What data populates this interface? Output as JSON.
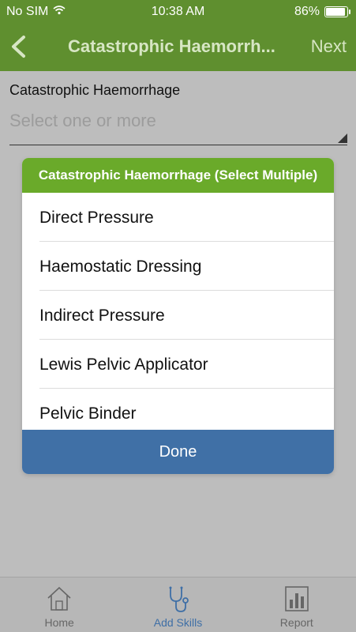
{
  "status_bar": {
    "carrier": "No SIM",
    "time": "10:38 AM",
    "battery_percent": "86%",
    "battery_level": 0.86,
    "icons": [
      "wifi-icon",
      "battery-icon"
    ]
  },
  "nav": {
    "title": "Catastrophic Haemorrh...",
    "next_label": "Next",
    "back_icon": "chevron-left-icon"
  },
  "form": {
    "field_label": "Catastrophic Haemorrhage",
    "placeholder": "Select one or more"
  },
  "modal": {
    "title": "Catastrophic Haemorrhage (Select Multiple)",
    "options": [
      "Direct Pressure",
      "Haemostatic Dressing",
      "Indirect Pressure",
      "Lewis Pelvic Applicator",
      "Pelvic Binder"
    ],
    "done_label": "Done"
  },
  "tabbar": {
    "tabs": [
      {
        "label": "Home",
        "icon": "home-icon",
        "active": false
      },
      {
        "label": "Add Skills",
        "icon": "stethoscope-icon",
        "active": true
      },
      {
        "label": "Report",
        "icon": "report-icon",
        "active": false
      }
    ]
  },
  "colors": {
    "header_green": "#5f8f2f",
    "modal_header_green": "#6aaa2a",
    "done_blue": "#4070a6",
    "active_tab_blue": "#3f6fa6"
  }
}
